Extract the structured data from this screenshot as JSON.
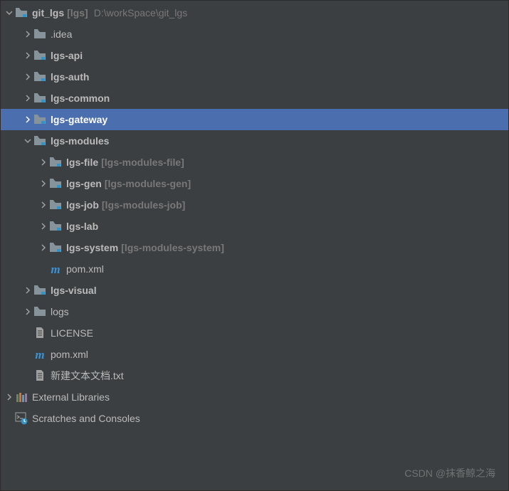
{
  "tree": {
    "root": {
      "name": "git_lgs",
      "bracket": "[lgs]",
      "path": "D:\\workSpace\\git_lgs"
    },
    "items": [
      {
        "name": ".idea",
        "icon": "folder",
        "bold": false,
        "indent": 1,
        "arrow": "right",
        "bracket": ""
      },
      {
        "name": "lgs-api",
        "icon": "module",
        "bold": true,
        "indent": 1,
        "arrow": "right",
        "bracket": ""
      },
      {
        "name": "lgs-auth",
        "icon": "module",
        "bold": true,
        "indent": 1,
        "arrow": "right",
        "bracket": ""
      },
      {
        "name": "lgs-common",
        "icon": "module",
        "bold": true,
        "indent": 1,
        "arrow": "right",
        "bracket": ""
      },
      {
        "name": "lgs-gateway",
        "icon": "module",
        "bold": true,
        "indent": 1,
        "arrow": "right",
        "bracket": "",
        "selected": true
      },
      {
        "name": "lgs-modules",
        "icon": "module",
        "bold": true,
        "indent": 1,
        "arrow": "down",
        "bracket": ""
      },
      {
        "name": "lgs-file",
        "icon": "module",
        "bold": true,
        "indent": 2,
        "arrow": "right",
        "bracket": "[lgs-modules-file]"
      },
      {
        "name": "lgs-gen",
        "icon": "module",
        "bold": true,
        "indent": 2,
        "arrow": "right",
        "bracket": "[lgs-modules-gen]"
      },
      {
        "name": "lgs-job",
        "icon": "module",
        "bold": true,
        "indent": 2,
        "arrow": "right",
        "bracket": "[lgs-modules-job]"
      },
      {
        "name": "lgs-lab",
        "icon": "module",
        "bold": true,
        "indent": 2,
        "arrow": "right",
        "bracket": ""
      },
      {
        "name": "lgs-system",
        "icon": "module",
        "bold": true,
        "indent": 2,
        "arrow": "right",
        "bracket": "[lgs-modules-system]"
      },
      {
        "name": "pom.xml",
        "icon": "maven",
        "bold": false,
        "indent": 2,
        "arrow": "",
        "bracket": ""
      },
      {
        "name": "lgs-visual",
        "icon": "module",
        "bold": true,
        "indent": 1,
        "arrow": "right",
        "bracket": ""
      },
      {
        "name": "logs",
        "icon": "folder",
        "bold": false,
        "indent": 1,
        "arrow": "right",
        "bracket": ""
      },
      {
        "name": "LICENSE",
        "icon": "file",
        "bold": false,
        "indent": 1,
        "arrow": "",
        "bracket": ""
      },
      {
        "name": "pom.xml",
        "icon": "maven",
        "bold": false,
        "indent": 1,
        "arrow": "",
        "bracket": ""
      },
      {
        "name": "新建文本文档.txt",
        "icon": "file",
        "bold": false,
        "indent": 1,
        "arrow": "",
        "bracket": ""
      }
    ],
    "external": "External Libraries",
    "scratches": "Scratches and Consoles"
  },
  "watermark": "CSDN @抹香鲸之海"
}
